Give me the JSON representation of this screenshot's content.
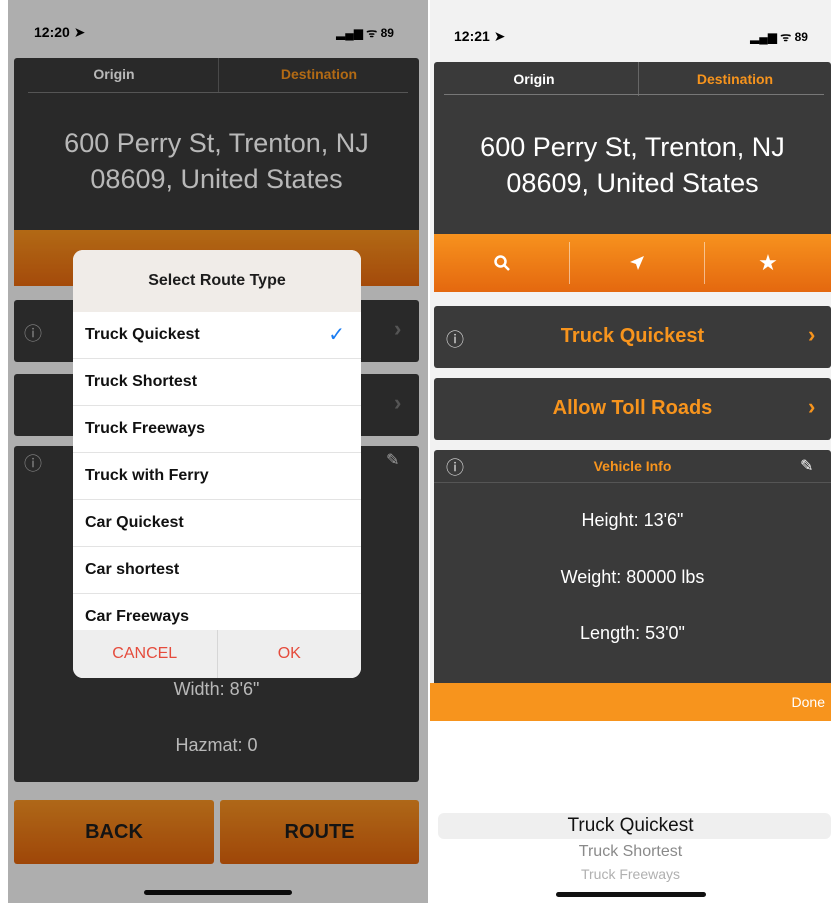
{
  "left": {
    "status": {
      "time": "12:20 ➤",
      "indicators": "▂▄▆ ᯤ 89"
    },
    "tabs": {
      "origin": "Origin",
      "destination": "Destination"
    },
    "address": {
      "line1": "600 Perry St, Trenton, NJ",
      "line2": "08609, United States"
    },
    "vehicle_peek": {
      "width": "Width: 8'6\"",
      "hazmat": "Hazmat: 0"
    },
    "buttons": {
      "back": "BACK",
      "route": "ROUTE"
    },
    "dialog": {
      "title": "Select Route Type",
      "options": [
        "Truck Quickest",
        "Truck Shortest",
        "Truck Freeways",
        "Truck with Ferry",
        "Car Quickest",
        "Car shortest",
        "Car Freeways"
      ],
      "selected": "Truck Quickest",
      "check": "✓",
      "cancel": "CANCEL",
      "ok": "OK"
    }
  },
  "right": {
    "status": {
      "time": "12:21 ➤",
      "indicators": "▂▄▆ ᯤ 89"
    },
    "tabs": {
      "origin": "Origin",
      "destination": "Destination"
    },
    "address": {
      "line1": "600 Perry St, Trenton, NJ",
      "line2": "08609, United States"
    },
    "actions": {
      "search": "search-icon",
      "location": "location-icon",
      "favorite": "star-icon"
    },
    "route_type": "Truck Quickest",
    "toll": "Allow Toll Roads",
    "vehicle": {
      "title": "Vehicle Info",
      "height": "Height: 13'6\"",
      "weight": "Weight: 80000 lbs",
      "length": "Length: 53'0\""
    },
    "done": "Done",
    "picker": {
      "selected": "Truck Quickest",
      "next1": "Truck Shortest",
      "next2": "Truck Freeways"
    }
  },
  "colors": {
    "accent": "#f7941d",
    "card": "#3a3a3a",
    "ios_blue": "#1a7cf2",
    "cancel_red": "#e54b3c"
  }
}
